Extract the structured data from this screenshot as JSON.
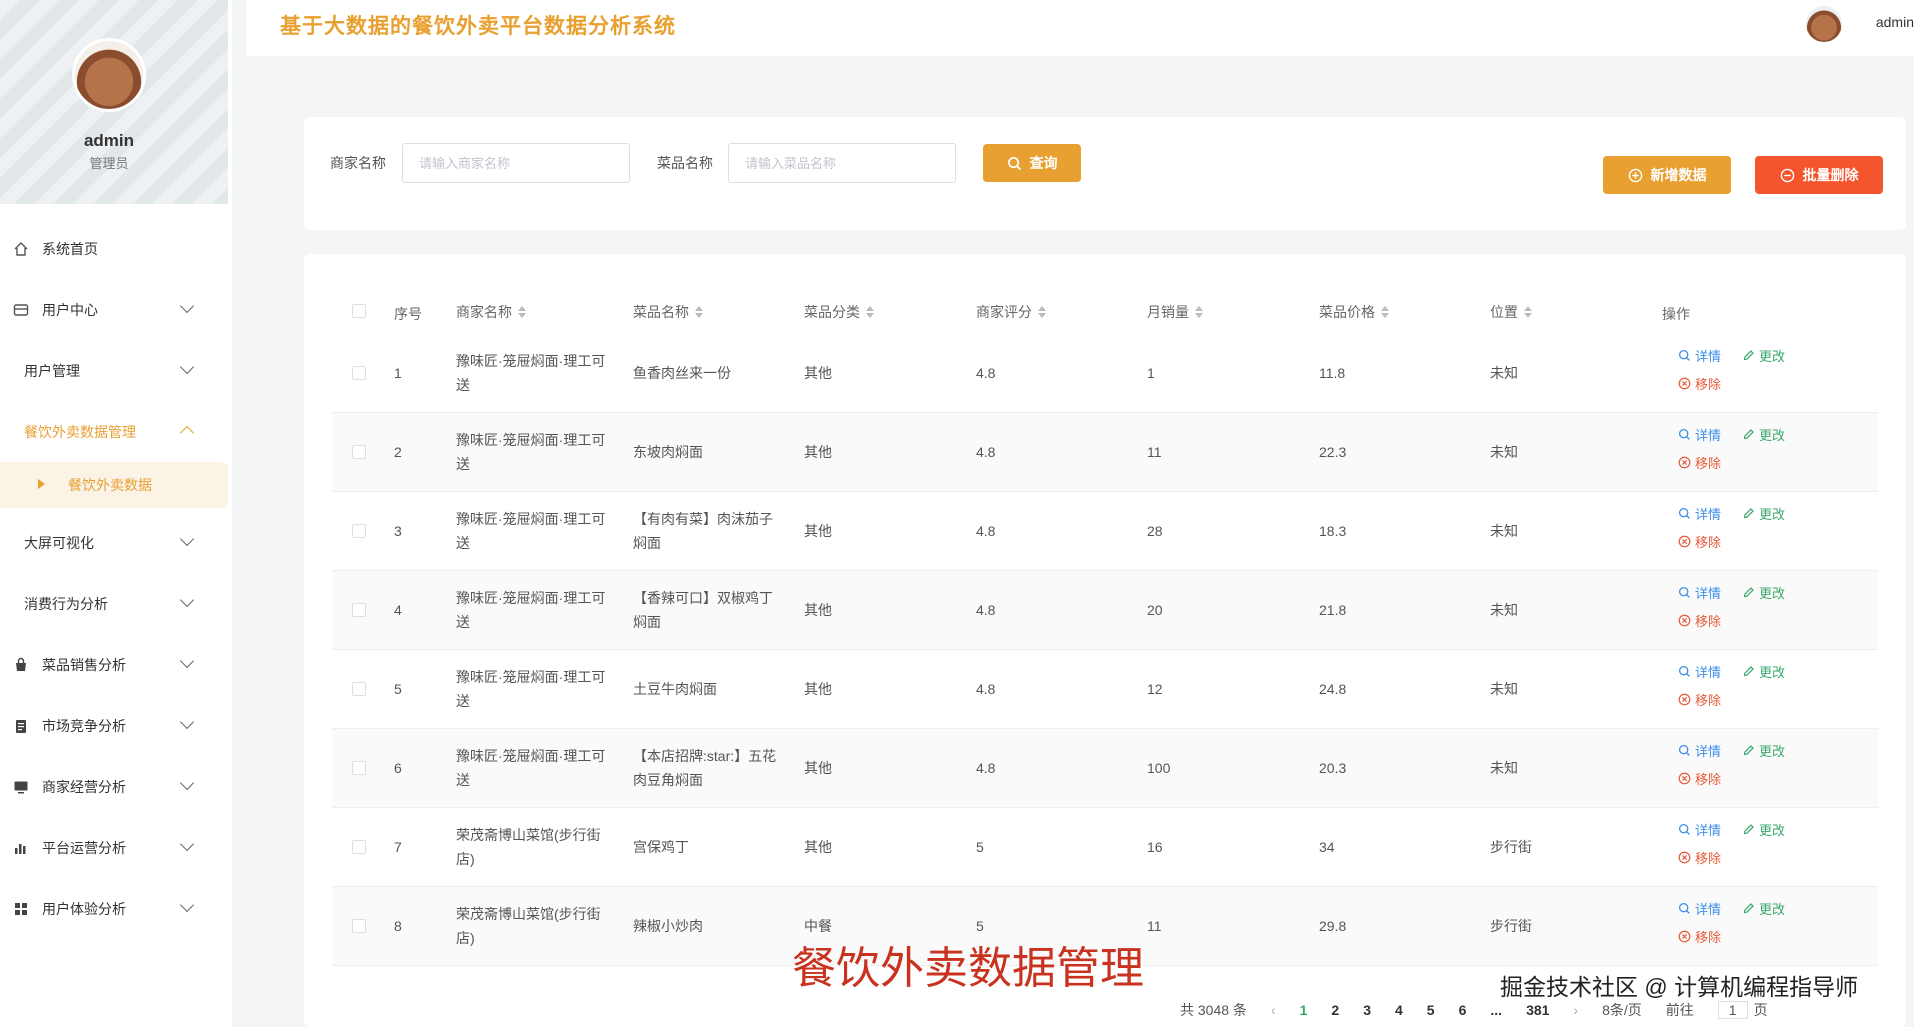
{
  "header": {
    "system_title": "基于大数据的餐饮外卖平台数据分析系统",
    "user": "admin"
  },
  "profile": {
    "name": "admin",
    "role": "管理员"
  },
  "sidebar": {
    "items": [
      {
        "label": "系统首页",
        "icon": "home-icon"
      },
      {
        "label": "用户中心",
        "icon": "user-card-icon"
      },
      {
        "label": "用户管理",
        "icon": ""
      },
      {
        "label": "餐饮外卖数据管理",
        "icon": ""
      },
      {
        "label": "餐饮外卖数据",
        "icon": "caret-right-icon"
      },
      {
        "label": "大屏可视化",
        "icon": ""
      },
      {
        "label": "消费行为分析",
        "icon": ""
      },
      {
        "label": "菜品销售分析",
        "icon": "bag-icon"
      },
      {
        "label": "市场竞争分析",
        "icon": "clipboard-icon"
      },
      {
        "label": "商家经营分析",
        "icon": "monitor-icon"
      },
      {
        "label": "平台运营分析",
        "icon": "bar-chart-icon"
      },
      {
        "label": "用户体验分析",
        "icon": "grid-icon"
      }
    ]
  },
  "search": {
    "merchant_label": "商家名称",
    "merchant_placeholder": "请输入商家名称",
    "dish_label": "菜品名称",
    "dish_placeholder": "请输入菜品名称",
    "query_button": "查询",
    "add_button": "新增数据",
    "batch_delete_button": "批量删除"
  },
  "table": {
    "columns": [
      "序号",
      "商家名称",
      "菜品名称",
      "菜品分类",
      "商家评分",
      "月销量",
      "菜品价格",
      "位置",
      "操作"
    ],
    "actions": {
      "detail": "详情",
      "edit": "更改",
      "remove": "移除"
    },
    "rows": [
      {
        "no": "1",
        "merchant": "豫味匠·笼屉焖面·理工可送",
        "dish": "鱼香肉丝来一份",
        "category": "其他",
        "rating": "4.8",
        "sales": "1",
        "price": "11.8",
        "location": "未知"
      },
      {
        "no": "2",
        "merchant": "豫味匠·笼屉焖面·理工可送",
        "dish": "东坡肉焖面",
        "category": "其他",
        "rating": "4.8",
        "sales": "11",
        "price": "22.3",
        "location": "未知"
      },
      {
        "no": "3",
        "merchant": "豫味匠·笼屉焖面·理工可送",
        "dish": "【有肉有菜】肉沫茄子焖面",
        "category": "其他",
        "rating": "4.8",
        "sales": "28",
        "price": "18.3",
        "location": "未知"
      },
      {
        "no": "4",
        "merchant": "豫味匠·笼屉焖面·理工可送",
        "dish": "【香辣可口】双椒鸡丁焖面",
        "category": "其他",
        "rating": "4.8",
        "sales": "20",
        "price": "21.8",
        "location": "未知"
      },
      {
        "no": "5",
        "merchant": "豫味匠·笼屉焖面·理工可送",
        "dish": "土豆牛肉焖面",
        "category": "其他",
        "rating": "4.8",
        "sales": "12",
        "price": "24.8",
        "location": "未知"
      },
      {
        "no": "6",
        "merchant": "豫味匠·笼屉焖面·理工可送",
        "dish": "【本店招牌:star:】五花肉豆角焖面",
        "category": "其他",
        "rating": "4.8",
        "sales": "100",
        "price": "20.3",
        "location": "未知"
      },
      {
        "no": "7",
        "merchant": "荣茂斋博山菜馆(步行街店)",
        "dish": "宫保鸡丁",
        "category": "其他",
        "rating": "5",
        "sales": "16",
        "price": "34",
        "location": "步行街"
      },
      {
        "no": "8",
        "merchant": "荣茂斋博山菜馆(步行街店)",
        "dish": "辣椒小炒肉",
        "category": "中餐",
        "rating": "5",
        "sales": "11",
        "price": "29.8",
        "location": "步行街"
      }
    ]
  },
  "pagination": {
    "total": "共 3048 条",
    "pages": [
      "1",
      "2",
      "3",
      "4",
      "5",
      "6",
      "...",
      "381"
    ],
    "page_size": "8条/页",
    "goto_label": "前往",
    "goto_value": "1",
    "page_suffix": "页"
  },
  "overlay": {
    "caption": "餐饮外卖数据管理",
    "watermark": "掘金技术社区 @ 计算机编程指导师"
  },
  "colors": {
    "accent": "#e8a030",
    "danger": "#f4552d",
    "link": "#3b8ee8",
    "edit": "#3aa76d"
  }
}
